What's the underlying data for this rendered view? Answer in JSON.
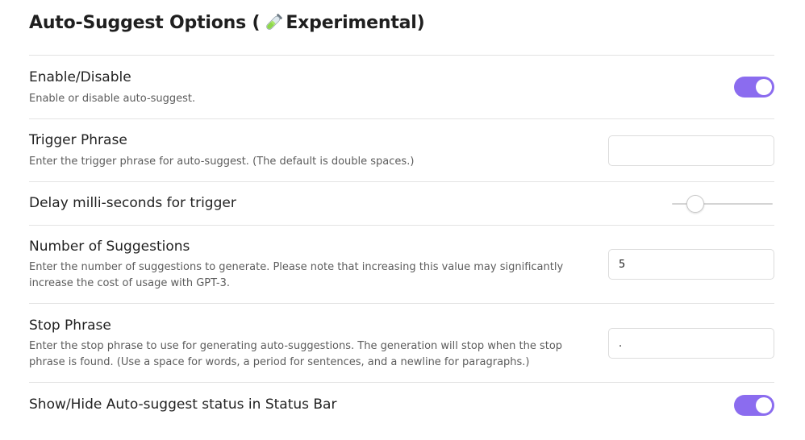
{
  "section": {
    "title_prefix": "Auto-Suggest Options (",
    "title_icon": "test-tube-icon",
    "title_suffix": "Experimental)"
  },
  "accent_color": "#8b6cef",
  "settings": {
    "enable": {
      "name": "Enable/Disable",
      "description": "Enable or disable auto-suggest.",
      "toggle_on": true
    },
    "trigger_phrase": {
      "name": "Trigger Phrase",
      "description": "Enter the trigger phrase for auto-suggest. (The default is double spaces.)",
      "value": "",
      "placeholder": ""
    },
    "delay": {
      "name": "Delay milli-seconds for trigger",
      "slider_level": 0.17
    },
    "num_suggestions": {
      "name": "Number of Suggestions",
      "description": "Enter the number of suggestions to generate. Please note that increasing this value may significantly increase the cost of usage with GPT-3.",
      "value": "5"
    },
    "stop_phrase": {
      "name": "Stop Phrase",
      "description": "Enter the stop phrase to use for generating auto-suggestions. The generation will stop when the stop phrase is found. (Use a space for words, a period for sentences, and a newline for paragraphs.)",
      "value": "."
    },
    "status_bar": {
      "name": "Show/Hide Auto-suggest status in Status Bar",
      "toggle_on": true
    }
  }
}
